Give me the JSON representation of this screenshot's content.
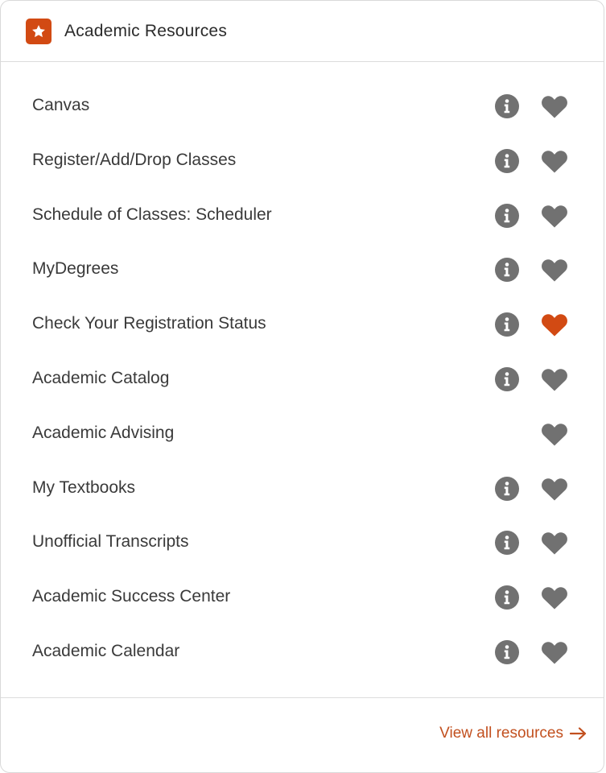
{
  "header": {
    "title": "Academic Resources",
    "icon": "star-icon",
    "icon_bg_color": "#d24a13"
  },
  "resources": [
    {
      "label": "Canvas",
      "has_info": true,
      "favorited": false
    },
    {
      "label": "Register/Add/Drop Classes",
      "has_info": true,
      "favorited": false
    },
    {
      "label": "Schedule of Classes: Scheduler",
      "has_info": true,
      "favorited": false
    },
    {
      "label": "MyDegrees",
      "has_info": true,
      "favorited": false
    },
    {
      "label": "Check Your Registration Status",
      "has_info": true,
      "favorited": true
    },
    {
      "label": "Academic Catalog",
      "has_info": true,
      "favorited": false
    },
    {
      "label": "Academic Advising",
      "has_info": false,
      "favorited": false
    },
    {
      "label": "My Textbooks",
      "has_info": true,
      "favorited": false
    },
    {
      "label": "Unofficial Transcripts",
      "has_info": true,
      "favorited": false
    },
    {
      "label": "Academic Success Center",
      "has_info": true,
      "favorited": false
    },
    {
      "label": "Academic Calendar",
      "has_info": true,
      "favorited": false
    }
  ],
  "footer": {
    "view_all_label": "View all resources",
    "icon": "arrow-right-icon"
  },
  "colors": {
    "accent": "#c2501f",
    "favorite_active": "#d24a13",
    "icon_gray": "#717171",
    "text": "#3a3a3a"
  }
}
